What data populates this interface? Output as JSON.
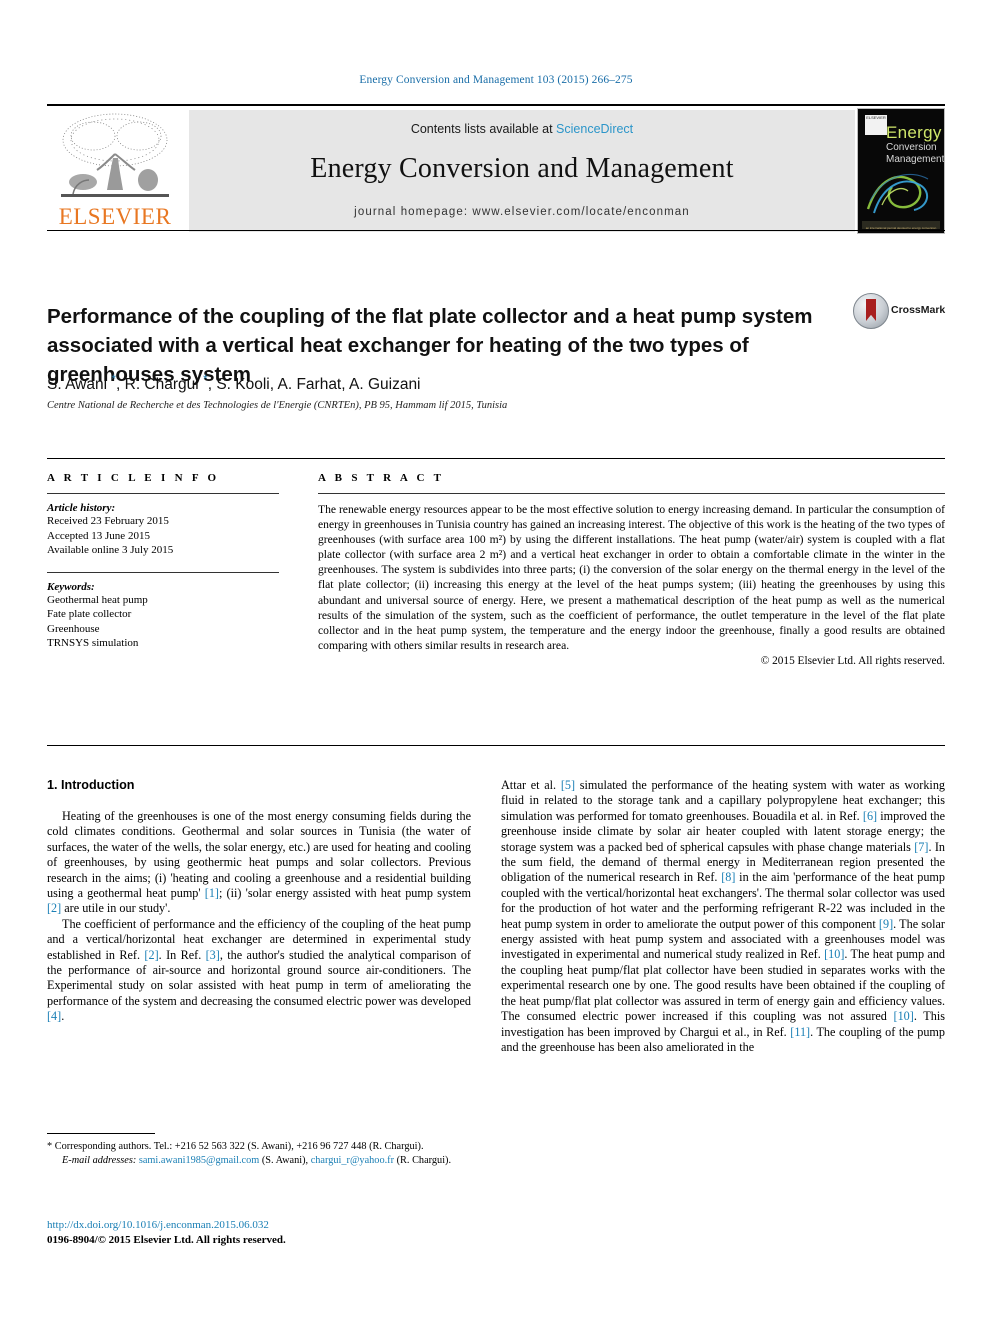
{
  "running_head": "Energy Conversion and Management 103 (2015) 266–275",
  "masthead": {
    "publisher": "ELSEVIER",
    "contents_prefix": "Contents lists available at ",
    "sciencedirect": "ScienceDirect",
    "journal_name": "Energy Conversion and Management",
    "homepage": "journal homepage: www.elsevier.com/locate/enconman",
    "cover": {
      "line1": "Energy",
      "line2": "Conversion",
      "line3": "Management",
      "logo_text": "ELSEVIER",
      "footer": "an international journal devoted to energy conversion"
    }
  },
  "article": {
    "title": "Performance of the coupling of the flat plate collector and a heat pump system associated with a vertical heat exchanger for heating of the two types of greenhouses system",
    "crossmark_label": "CrossMark",
    "authors_html": "S. Awani <sup>*</sup>, R. Chargui <sup>*</sup>, S. Kooli, A. Farhat, A. Guizani",
    "affiliation": "Centre National de Recherche et des Technologies de l'Energie (CNRTEn), PB 95, Hammam lif 2015, Tunisia"
  },
  "article_info": {
    "heading": "A R T I C L E   I N F O",
    "history_label": "Article history:",
    "history": [
      "Received 23 February 2015",
      "Accepted 13 June 2015",
      "Available online 3 July 2015"
    ],
    "keywords_label": "Keywords:",
    "keywords": [
      "Geothermal heat pump",
      "Fate plate collector",
      "Greenhouse",
      "TRNSYS simulation"
    ]
  },
  "abstract": {
    "heading": "A B S T R A C T",
    "text": "The renewable energy resources appear to be the most effective solution to energy increasing demand. In particular the consumption of energy in greenhouses in Tunisia country has gained an increasing interest. The objective of this work is the heating of the two types of greenhouses (with surface area 100 m²) by using the different installations. The heat pump (water/air) system is coupled with a flat plate collector (with surface area 2 m²) and a vertical heat exchanger in order to obtain a comfortable climate in the winter in the greenhouses. The system is subdivides into three parts; (i) the conversion of the solar energy on the thermal energy in the level of the flat plate collector; (ii) increasing this energy at the level of the heat pumps system; (iii) heating the greenhouses by using this abundant and universal source of energy. Here, we present a mathematical description of the heat pump as well as the numerical results of the simulation of the system, such as the coefficient of performance, the outlet temperature in the level of the flat plate collector and in the heat pump system, the temperature and the energy indoor the greenhouse, finally a good results are obtained comparing with others similar results in research area.",
    "copyright": "© 2015 Elsevier Ltd. All rights reserved."
  },
  "body": {
    "section_heading": "1. Introduction",
    "left_par1_a": "Heating of the greenhouses is one of the most energy consuming fields during the cold climates conditions. Geothermal and solar sources in Tunisia (the water of surfaces, the water of the wells, the solar energy, etc.) are used for heating and cooling of greenhouses, by using geothermic heat pumps and solar collectors. Previous research in the aims; (i) 'heating and cooling a greenhouse and a residential building using a geothermal heat pump' ",
    "left_par1_ref1": "[1]",
    "left_par1_b": "; (ii) 'solar energy assisted with heat pump system ",
    "left_par1_ref2": "[2]",
    "left_par1_c": " are utile in our study'.",
    "left_par2_a": "The coefficient of performance and the efficiency of the coupling of the heat pump and a vertical/horizontal heat exchanger are determined in experimental study established in Ref. ",
    "left_par2_ref1": "[2]",
    "left_par2_b": ". In Ref. ",
    "left_par2_ref2": "[3]",
    "left_par2_c": ", the author's studied the analytical comparison of the performance of air-source and horizontal ground source air-conditioners. The Experimental study on solar assisted with heat pump in term of ameliorating the performance of the system and decreasing the consumed electric power was developed ",
    "left_par2_ref3": "[4]",
    "left_par2_d": ".",
    "right_par_a": "Attar et al. ",
    "right_ref5": "[5]",
    "right_par_b": " simulated the performance of the heating system with water as working fluid in related to the storage tank and a capillary polypropylene heat exchanger; this simulation was performed for tomato greenhouses. Bouadila et al. in Ref. ",
    "right_ref6": "[6]",
    "right_par_c": " improved the greenhouse inside climate by solar air heater coupled with latent storage energy; the storage system was a packed bed of spherical capsules with phase change materials ",
    "right_ref7": "[7]",
    "right_par_d": ". In the sum field, the demand of thermal energy in Mediterranean region presented the obligation of the numerical research in Ref. ",
    "right_ref8": "[8]",
    "right_par_e": " in the aim 'performance of the heat pump coupled with the vertical/horizontal heat exchangers'. The thermal solar collector was used for the production of hot water and the performing refrigerant R-22 was included in the heat pump system in order to ameliorate the output power of this component ",
    "right_ref9": "[9]",
    "right_par_f": ". The solar energy assisted with heat pump system and associated with a greenhouses model was investigated in experimental and numerical study realized in Ref. ",
    "right_ref10": "[10]",
    "right_par_g": ". The heat pump and the coupling heat pump/flat plat collector have been studied in separates works with the experimental research one by one. The good results have been obtained if the coupling of the heat pump/flat plat collector was assured in term of energy gain and efficiency values. The consumed electric power increased if this coupling was not assured ",
    "right_ref10b": "[10]",
    "right_par_h": ". This investigation has been improved by Chargui et al., in Ref. ",
    "right_ref11": "[11]",
    "right_par_i": ". The coupling of the pump and the greenhouse has been also ameliorated in the"
  },
  "footnotes": {
    "corresponding": "* Corresponding authors. Tel.: +216 52 563 322 (S. Awani), +216 96 727 448 (R. Chargui).",
    "email_label": "E-mail addresses:",
    "email1": "sami.awani1985@gmail.com",
    "email1_owner": " (S. Awani), ",
    "email2": "chargui_r@yahoo.fr",
    "email2_owner": " (R. Chargui)."
  },
  "footer": {
    "doi": "http://dx.doi.org/10.1016/j.enconman.2015.06.032",
    "issn": "0196-8904/© 2015 Elsevier Ltd. All rights reserved."
  },
  "colors": {
    "link": "#1a7fb5",
    "running_head": "#1a6ea8",
    "elsevier_orange": "#e87722",
    "band_gray": "#e6e6e6"
  }
}
